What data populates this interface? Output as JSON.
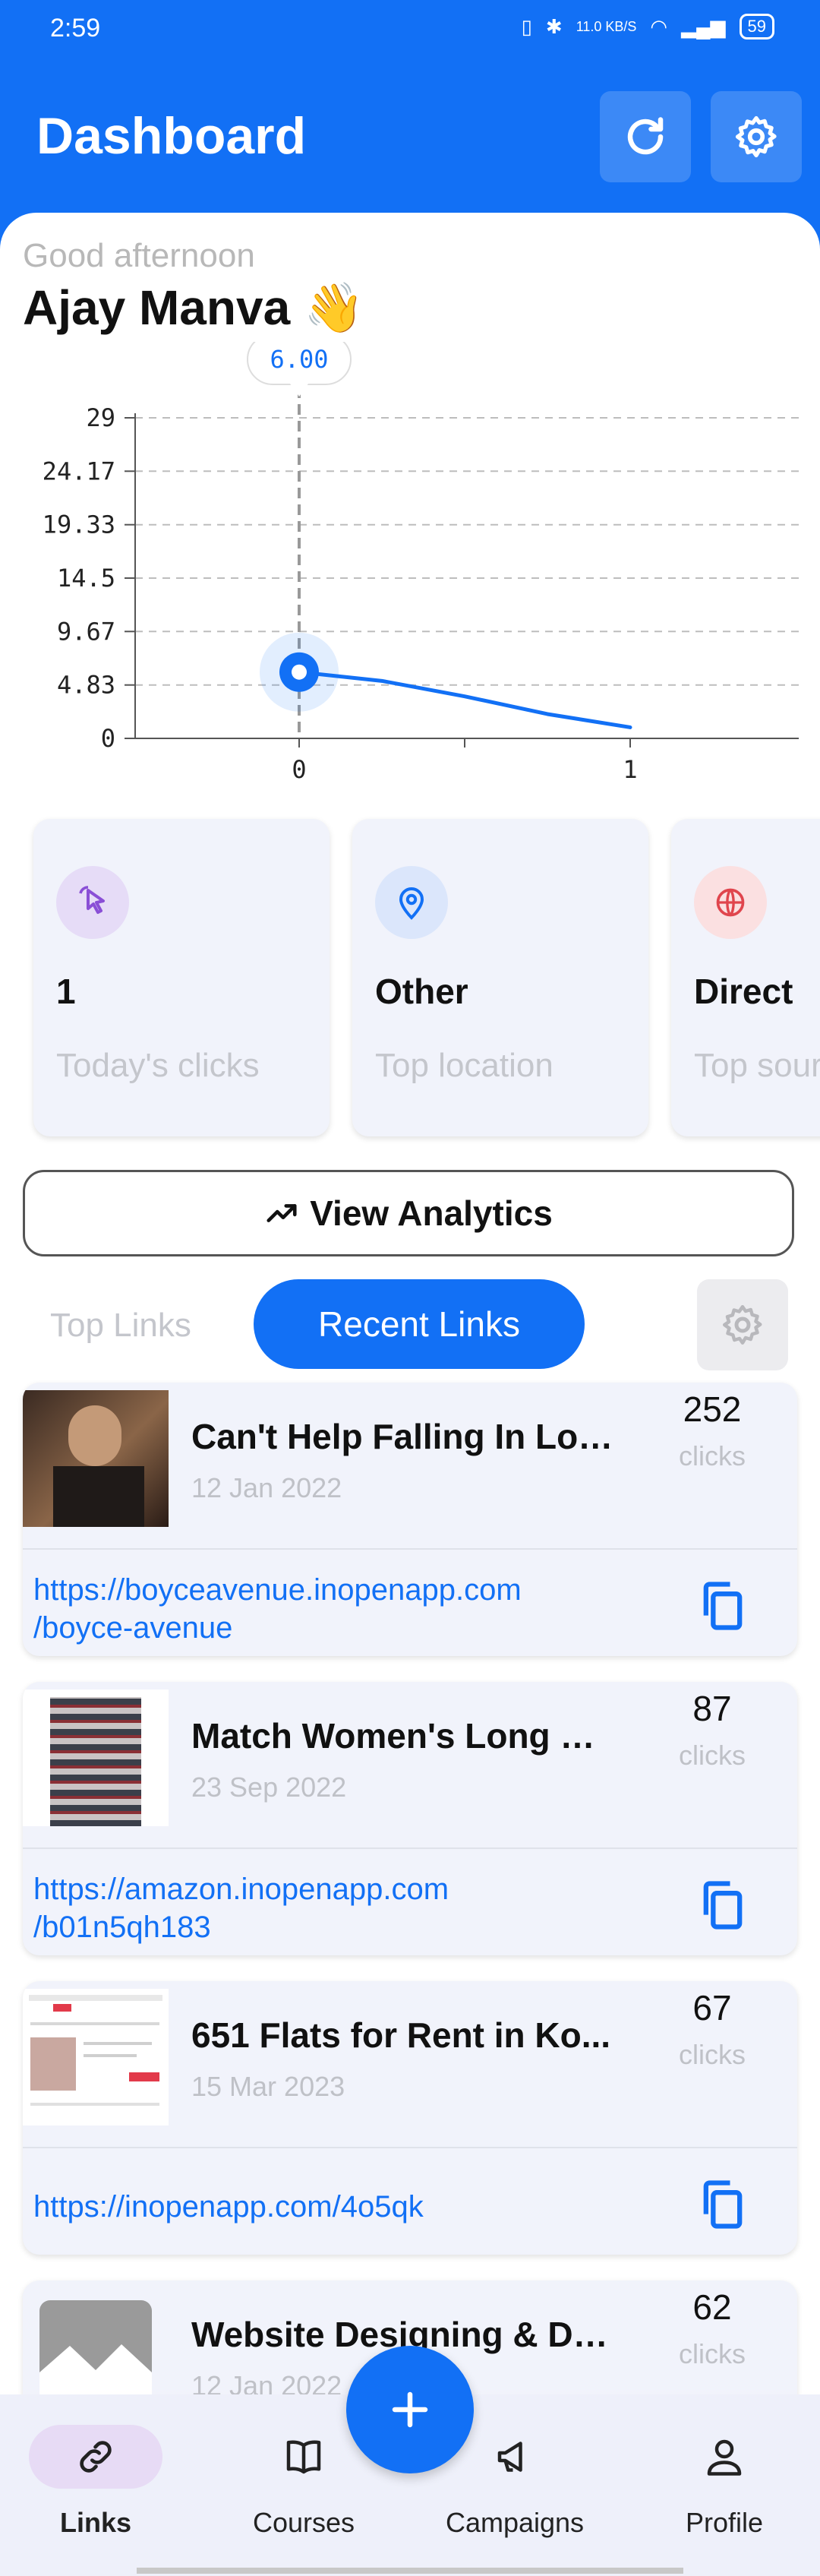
{
  "status_bar": {
    "time": "2:59",
    "network_speed": "11.0 KB/S",
    "battery": "59"
  },
  "header": {
    "title": "Dashboard",
    "refresh_icon": "refresh-icon",
    "settings_icon": "gear-icon"
  },
  "greeting": {
    "text": "Good afternoon",
    "name": "Ajay Manva",
    "emoji": "👋"
  },
  "chart_data": {
    "type": "line",
    "x": [
      0,
      0.25,
      0.5,
      0.75,
      1
    ],
    "y": [
      6.0,
      5.2,
      3.8,
      2.2,
      1.0
    ],
    "xticks": [
      "0",
      "1"
    ],
    "yticks": [
      "29",
      "24.17",
      "19.33",
      "14.5",
      "9.67",
      "4.83",
      "0"
    ],
    "ylim": [
      0,
      29
    ],
    "tooltip": "6.00",
    "grid": true,
    "color": "#1270f5"
  },
  "stats": [
    {
      "value": "1",
      "label": "Today's clicks",
      "icon": "cursor-click-icon",
      "color": "#8a4fd6"
    },
    {
      "value": "Other",
      "label": "Top location",
      "icon": "location-pin-icon",
      "color": "#1270f5"
    },
    {
      "value": "Direct",
      "label": "Top source",
      "icon": "globe-icon",
      "color": "#e0454d"
    }
  ],
  "analytics_button": {
    "label": "View Analytics"
  },
  "tabs": {
    "top": "Top Links",
    "recent": "Recent Links"
  },
  "links": [
    {
      "title": "Can't Help Falling In Lov...",
      "date": "12 Jan 2022",
      "clicks": "252",
      "clicks_label": "clicks",
      "url_line1": "https://boyceavenue.inopenapp.com",
      "url_line2": "/boyce-avenue"
    },
    {
      "title": "Match Women's Long Sl...",
      "date": "23 Sep 2022",
      "clicks": "87",
      "clicks_label": "clicks",
      "url_line1": "https://amazon.inopenapp.com",
      "url_line2": "/b01n5qh183"
    },
    {
      "title": "651   Flats for Rent in Ko...",
      "date": "15 Mar 2023",
      "clicks": "67",
      "clicks_label": "clicks",
      "url_line1": "https://inopenapp.com/4o5qk",
      "url_line2": ""
    },
    {
      "title": "Website Designing & De...",
      "date": "12 Jan 2022",
      "clicks": "62",
      "clicks_label": "clicks",
      "url_line1": "",
      "url_line2": ""
    }
  ],
  "nav": [
    {
      "label": "Links",
      "icon": "link-icon"
    },
    {
      "label": "Courses",
      "icon": "book-icon"
    },
    {
      "label": "Campaigns",
      "icon": "megaphone-icon"
    },
    {
      "label": "Profile",
      "icon": "person-icon"
    }
  ],
  "fab": {
    "icon": "plus-icon"
  }
}
